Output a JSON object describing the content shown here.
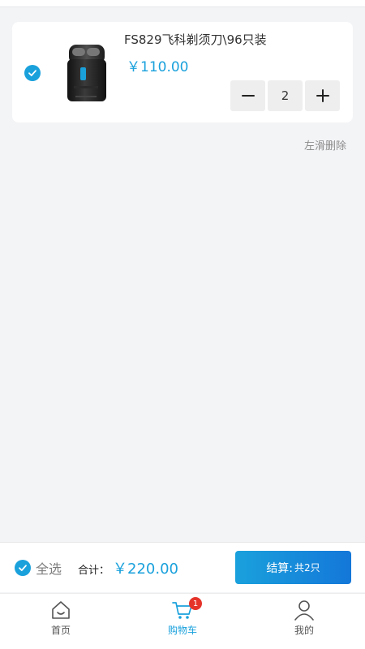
{
  "cart": {
    "items": [
      {
        "name": "FS829飞科剃须刀\\96只装",
        "price": "￥110.00",
        "quantity": "2",
        "selected": true
      }
    ],
    "swipe_hint": "左滑删除"
  },
  "footer": {
    "select_all_label": "全选",
    "total_label": "合计：",
    "total_value": "￥220.00",
    "checkout_label": "结算:",
    "checkout_count": "共2只"
  },
  "tabbar": {
    "tabs": [
      {
        "label": "首页",
        "icon": "home-icon",
        "active": false
      },
      {
        "label": "购物车",
        "icon": "cart-icon",
        "active": true,
        "badge": "1"
      },
      {
        "label": "我的",
        "icon": "user-icon",
        "active": false
      }
    ]
  },
  "colors": {
    "accent": "#1aa1dc",
    "badge": "#e5332a",
    "background": "#f3f4f6"
  }
}
